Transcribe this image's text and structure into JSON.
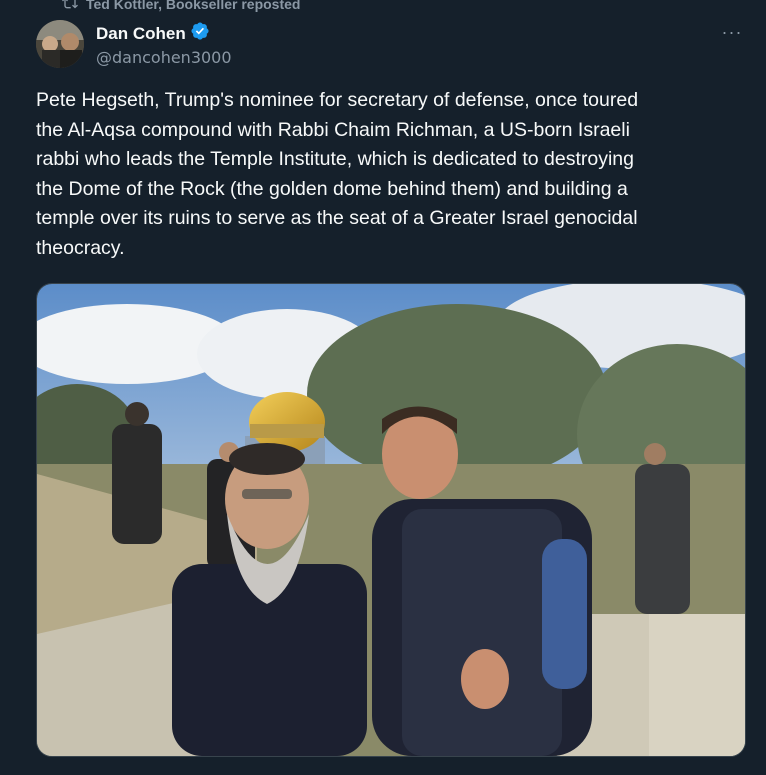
{
  "repost": {
    "label": "Ted Kottler, Bookseller reposted",
    "icon": "repost-icon"
  },
  "author": {
    "display_name": "Dan Cohen",
    "handle": "@dancohen3000",
    "verified": true,
    "verified_color": "#1d9bf0"
  },
  "more_label": "···",
  "tweet": {
    "text": "Pete Hegseth, Trump's nominee for secretary of defense, once toured\nthe Al-Aqsa compound with Rabbi Chaim Richman, a US-born Israeli\nrabbi who leads the Temple Institute, which is dedicated to destroying\nthe Dome of the Rock (the golden dome behind them) and building a\ntemple over its ruins to serve as the seat of a Greater Israel genocidal\ntheocracy."
  },
  "colors": {
    "background": "#15202b",
    "text_primary": "#f7f9f9",
    "text_secondary": "#8b98a5",
    "dome_gold": "#d4a52a"
  }
}
